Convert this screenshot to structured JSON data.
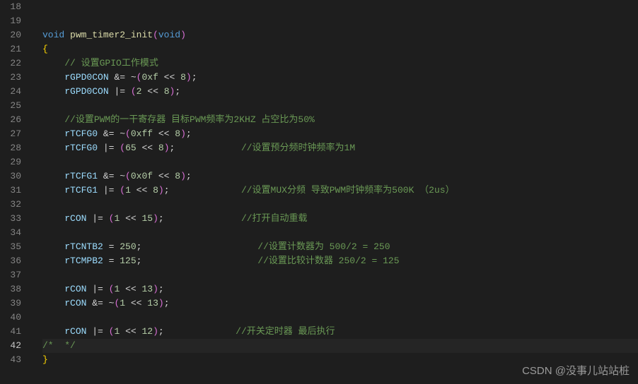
{
  "active_line": 42,
  "watermark": "CSDN @没事儿站站桩",
  "lines": [
    {
      "num": 18,
      "tokens": []
    },
    {
      "num": 19,
      "tokens": []
    },
    {
      "num": 20,
      "tokens": [
        {
          "t": "void",
          "c": "kw"
        },
        {
          "t": " ",
          "c": "op"
        },
        {
          "t": "pwm_timer2_init",
          "c": "fn"
        },
        {
          "t": "(",
          "c": "paren"
        },
        {
          "t": "void",
          "c": "kw"
        },
        {
          "t": ")",
          "c": "paren"
        }
      ]
    },
    {
      "num": 21,
      "tokens": [
        {
          "t": "{",
          "c": "brace"
        }
      ]
    },
    {
      "num": 22,
      "tokens": [
        {
          "t": "    ",
          "c": "op"
        },
        {
          "t": "// 设置GPIO工作模式",
          "c": "cmt"
        }
      ]
    },
    {
      "num": 23,
      "tokens": [
        {
          "t": "    ",
          "c": "op"
        },
        {
          "t": "rGPD0CON",
          "c": "var"
        },
        {
          "t": " &= ~",
          "c": "op"
        },
        {
          "t": "(",
          "c": "paren"
        },
        {
          "t": "0xf",
          "c": "num"
        },
        {
          "t": " << ",
          "c": "op"
        },
        {
          "t": "8",
          "c": "num"
        },
        {
          "t": ")",
          "c": "paren"
        },
        {
          "t": ";",
          "c": "op"
        }
      ]
    },
    {
      "num": 24,
      "tokens": [
        {
          "t": "    ",
          "c": "op"
        },
        {
          "t": "rGPD0CON",
          "c": "var"
        },
        {
          "t": " |= ",
          "c": "op"
        },
        {
          "t": "(",
          "c": "paren"
        },
        {
          "t": "2",
          "c": "num"
        },
        {
          "t": " << ",
          "c": "op"
        },
        {
          "t": "8",
          "c": "num"
        },
        {
          "t": ")",
          "c": "paren"
        },
        {
          "t": ";",
          "c": "op"
        }
      ]
    },
    {
      "num": 25,
      "tokens": []
    },
    {
      "num": 26,
      "tokens": [
        {
          "t": "    ",
          "c": "op"
        },
        {
          "t": "//设置PWM的一干寄存器 目标PWM频率为2KHZ 占空比为50%",
          "c": "cmt"
        }
      ]
    },
    {
      "num": 27,
      "tokens": [
        {
          "t": "    ",
          "c": "op"
        },
        {
          "t": "rTCFG0",
          "c": "var"
        },
        {
          "t": " &= ~",
          "c": "op"
        },
        {
          "t": "(",
          "c": "paren"
        },
        {
          "t": "0xff",
          "c": "num"
        },
        {
          "t": " << ",
          "c": "op"
        },
        {
          "t": "8",
          "c": "num"
        },
        {
          "t": ")",
          "c": "paren"
        },
        {
          "t": ";",
          "c": "op"
        }
      ]
    },
    {
      "num": 28,
      "tokens": [
        {
          "t": "    ",
          "c": "op"
        },
        {
          "t": "rTCFG0",
          "c": "var"
        },
        {
          "t": " |= ",
          "c": "op"
        },
        {
          "t": "(",
          "c": "paren"
        },
        {
          "t": "65",
          "c": "num"
        },
        {
          "t": " << ",
          "c": "op"
        },
        {
          "t": "8",
          "c": "num"
        },
        {
          "t": ")",
          "c": "paren"
        },
        {
          "t": ";",
          "c": "op"
        },
        {
          "t": "            ",
          "c": "op"
        },
        {
          "t": "//设置预分频时钟频率为1M",
          "c": "cmt"
        }
      ]
    },
    {
      "num": 29,
      "tokens": []
    },
    {
      "num": 30,
      "tokens": [
        {
          "t": "    ",
          "c": "op"
        },
        {
          "t": "rTCFG1",
          "c": "var"
        },
        {
          "t": " &= ~",
          "c": "op"
        },
        {
          "t": "(",
          "c": "paren"
        },
        {
          "t": "0x0f",
          "c": "num"
        },
        {
          "t": " << ",
          "c": "op"
        },
        {
          "t": "8",
          "c": "num"
        },
        {
          "t": ")",
          "c": "paren"
        },
        {
          "t": ";",
          "c": "op"
        }
      ]
    },
    {
      "num": 31,
      "tokens": [
        {
          "t": "    ",
          "c": "op"
        },
        {
          "t": "rTCFG1",
          "c": "var"
        },
        {
          "t": " |= ",
          "c": "op"
        },
        {
          "t": "(",
          "c": "paren"
        },
        {
          "t": "1",
          "c": "num"
        },
        {
          "t": " << ",
          "c": "op"
        },
        {
          "t": "8",
          "c": "num"
        },
        {
          "t": ")",
          "c": "paren"
        },
        {
          "t": ";",
          "c": "op"
        },
        {
          "t": "             ",
          "c": "op"
        },
        {
          "t": "//设置MUX分频 导致PWM时钟频率为500K （2us）",
          "c": "cmt"
        }
      ]
    },
    {
      "num": 32,
      "tokens": []
    },
    {
      "num": 33,
      "tokens": [
        {
          "t": "    ",
          "c": "op"
        },
        {
          "t": "rCON",
          "c": "var"
        },
        {
          "t": " |= ",
          "c": "op"
        },
        {
          "t": "(",
          "c": "paren"
        },
        {
          "t": "1",
          "c": "num"
        },
        {
          "t": " << ",
          "c": "op"
        },
        {
          "t": "15",
          "c": "num"
        },
        {
          "t": ")",
          "c": "paren"
        },
        {
          "t": ";",
          "c": "op"
        },
        {
          "t": "              ",
          "c": "op"
        },
        {
          "t": "//打开自动重载",
          "c": "cmt"
        }
      ]
    },
    {
      "num": 34,
      "tokens": []
    },
    {
      "num": 35,
      "tokens": [
        {
          "t": "    ",
          "c": "op"
        },
        {
          "t": "rTCNTB2",
          "c": "var"
        },
        {
          "t": " = ",
          "c": "op"
        },
        {
          "t": "250",
          "c": "num"
        },
        {
          "t": ";",
          "c": "op"
        },
        {
          "t": "                     ",
          "c": "op"
        },
        {
          "t": "//设置计数器为 500/2 = 250",
          "c": "cmt"
        }
      ]
    },
    {
      "num": 36,
      "tokens": [
        {
          "t": "    ",
          "c": "op"
        },
        {
          "t": "rTCMPB2",
          "c": "var"
        },
        {
          "t": " = ",
          "c": "op"
        },
        {
          "t": "125",
          "c": "num"
        },
        {
          "t": ";",
          "c": "op"
        },
        {
          "t": "                     ",
          "c": "op"
        },
        {
          "t": "//设置比较计数器 250/2 = 125",
          "c": "cmt"
        }
      ]
    },
    {
      "num": 37,
      "tokens": []
    },
    {
      "num": 38,
      "tokens": [
        {
          "t": "    ",
          "c": "op"
        },
        {
          "t": "rCON",
          "c": "var"
        },
        {
          "t": " |= ",
          "c": "op"
        },
        {
          "t": "(",
          "c": "paren"
        },
        {
          "t": "1",
          "c": "num"
        },
        {
          "t": " << ",
          "c": "op"
        },
        {
          "t": "13",
          "c": "num"
        },
        {
          "t": ")",
          "c": "paren"
        },
        {
          "t": ";",
          "c": "op"
        }
      ]
    },
    {
      "num": 39,
      "tokens": [
        {
          "t": "    ",
          "c": "op"
        },
        {
          "t": "rCON",
          "c": "var"
        },
        {
          "t": " &= ~",
          "c": "op"
        },
        {
          "t": "(",
          "c": "paren"
        },
        {
          "t": "1",
          "c": "num"
        },
        {
          "t": " << ",
          "c": "op"
        },
        {
          "t": "13",
          "c": "num"
        },
        {
          "t": ")",
          "c": "paren"
        },
        {
          "t": ";",
          "c": "op"
        }
      ]
    },
    {
      "num": 40,
      "tokens": []
    },
    {
      "num": 41,
      "tokens": [
        {
          "t": "    ",
          "c": "op"
        },
        {
          "t": "rCON",
          "c": "var"
        },
        {
          "t": " |= ",
          "c": "op"
        },
        {
          "t": "(",
          "c": "paren"
        },
        {
          "t": "1",
          "c": "num"
        },
        {
          "t": " << ",
          "c": "op"
        },
        {
          "t": "12",
          "c": "num"
        },
        {
          "t": ")",
          "c": "paren"
        },
        {
          "t": ";",
          "c": "op"
        },
        {
          "t": "             ",
          "c": "op"
        },
        {
          "t": "//开关定时器 最后执行",
          "c": "cmt"
        }
      ]
    },
    {
      "num": 42,
      "tokens": [
        {
          "t": "/*  */",
          "c": "cmt"
        }
      ]
    },
    {
      "num": 43,
      "tokens": [
        {
          "t": "}",
          "c": "brace"
        }
      ]
    }
  ]
}
